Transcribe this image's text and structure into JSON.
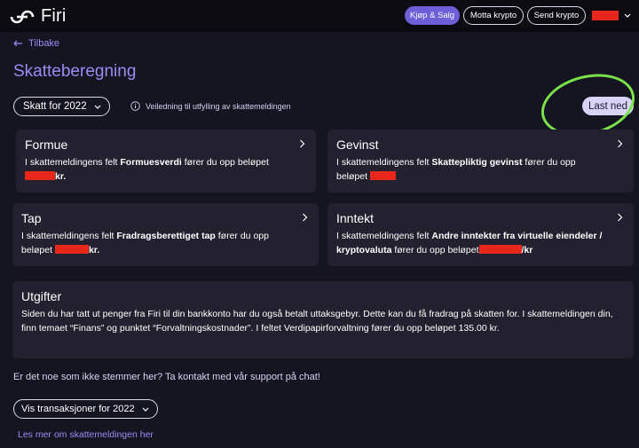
{
  "header": {
    "logo_text": "Firi",
    "buttons": {
      "buy_sell": "Kjøp & Salg",
      "receive": "Motta krypto",
      "send": "Send krypto"
    },
    "user_menu_color": "#e8271c"
  },
  "back_label": "Tilbake",
  "page_title": "Skatteberegning",
  "year_select": "Skatt for 2022",
  "guide_link": "Veiledning til utfylling av skattemeldingen",
  "download_label": "Last ned",
  "cards": {
    "formue": {
      "title": "Formue",
      "pre": "I skattemeldingens felt ",
      "field": "Formuesverdi",
      "post": " fører du opp beløpet",
      "suffix": "kr."
    },
    "gevinst": {
      "title": "Gevinst",
      "pre": "I skattemeldingens felt ",
      "field": "Skattepliktig gevinst",
      "post": " fører du opp",
      "line2": "beløpet "
    },
    "tap": {
      "title": "Tap",
      "pre": "I skattemeldingens felt ",
      "field": "Fradragsberettiget tap",
      "post": " fører du opp",
      "line2": "beløpet ",
      "suffix": "kr."
    },
    "inntekt": {
      "title": "Inntekt",
      "pre": "I skattemeldingens felt ",
      "field": "Andre inntekter fra virtuelle eiendeler / kryptovaluta",
      "post": " fører du opp beløpet",
      "suffix": "/kr"
    },
    "utgifter": {
      "title": "Utgifter",
      "text": "Siden du har tatt ut penger fra Firi til din bankkonto har du også betalt uttaksgebyr. Dette kan du få fradrag på skatten for. I skattemeldingen din, finn temaet “Finans” og punktet “Forvaltningskostnader”. I feltet Verdipapirforvaltning fører du opp beløpet 135.00 kr."
    }
  },
  "question": "Er det noe som ikke stemmer her? Ta kontakt med vår support på chat!",
  "transactions_button": "Vis transaksjoner for 2022",
  "learn_more": "Les mer om skattemeldingen her",
  "colors": {
    "accent": "#9a8cf7",
    "primary_button": "#6d5fd8",
    "card_bg": "#23212f",
    "highlight": "#7be24a",
    "redaction": "#e8271c"
  }
}
